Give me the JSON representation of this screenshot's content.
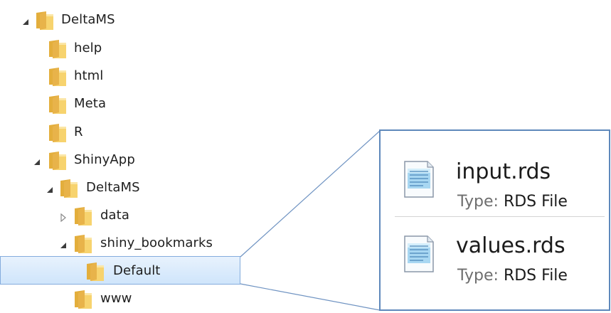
{
  "tree": {
    "items": [
      {
        "label": "DeltaMS",
        "expander": "expanded"
      },
      {
        "label": "help",
        "expander": "none"
      },
      {
        "label": "html",
        "expander": "none"
      },
      {
        "label": "Meta",
        "expander": "none"
      },
      {
        "label": "R",
        "expander": "none"
      },
      {
        "label": "ShinyApp",
        "expander": "expanded"
      },
      {
        "label": "DeltaMS",
        "expander": "expanded"
      },
      {
        "label": "data",
        "expander": "collapsed"
      },
      {
        "label": "shiny_bookmarks",
        "expander": "expanded"
      },
      {
        "label": "Default",
        "expander": "none",
        "selected": true
      },
      {
        "label": "www",
        "expander": "none"
      }
    ]
  },
  "details": {
    "type_label": "Type:",
    "files": [
      {
        "name": "input.rds",
        "type": "RDS File",
        "icon": "rds-file-icon"
      },
      {
        "name": "values.rds",
        "type": "RDS File",
        "icon": "rds-file-icon"
      }
    ]
  },
  "colors": {
    "selection": "#cfe5fb",
    "selection_border": "#84acdd",
    "callout_border": "#5e88bb",
    "folder": "#f2c75c"
  }
}
